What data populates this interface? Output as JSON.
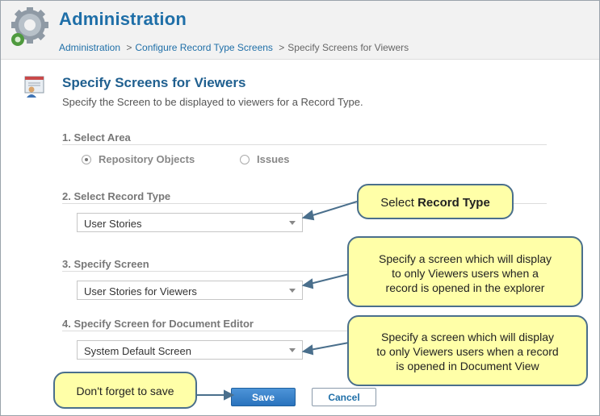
{
  "header": {
    "title": "Administration",
    "breadcrumb": {
      "crumb1": "Administration",
      "crumb2": "Configure Record Type Screens",
      "current": "Specify Screens for Viewers",
      "separator": ">"
    }
  },
  "page": {
    "title": "Specify Screens for Viewers",
    "description": "Specify the Screen to be displayed to viewers for a Record Type."
  },
  "sections": {
    "area": {
      "label": "1. Select Area",
      "options": [
        "Repository Objects",
        "Issues"
      ],
      "selected": "Repository Objects"
    },
    "record_type": {
      "label": "2. Select Record Type",
      "value": "User Stories"
    },
    "screen": {
      "label": "3. Specify Screen",
      "value": "User Stories for Viewers"
    },
    "doc_editor": {
      "label": "4. Specify Screen for Document Editor",
      "value": "System Default Screen"
    }
  },
  "buttons": {
    "save": "Save",
    "cancel": "Cancel"
  },
  "callouts": {
    "record_type_prefix": "Select",
    "record_type_bold": "Record Type",
    "screen_line1": "Specify a screen which will display",
    "screen_line2": "to only Viewers users when a",
    "screen_line3": "record is opened in the explorer",
    "doc_line1": "Specify a screen which will display",
    "doc_line2": "to only Viewers users when a record",
    "doc_line3": "is opened in Document View",
    "save": "Don't forget to save"
  },
  "colors": {
    "title_blue": "#1f6fa8",
    "callout_fill": "#ffffa8",
    "callout_border": "#4a6f8c",
    "save_button": "#2a73bd"
  },
  "icons": {
    "header": "gear-icon",
    "page": "user-screen-icon",
    "dropdown": "chevron-down-icon"
  }
}
